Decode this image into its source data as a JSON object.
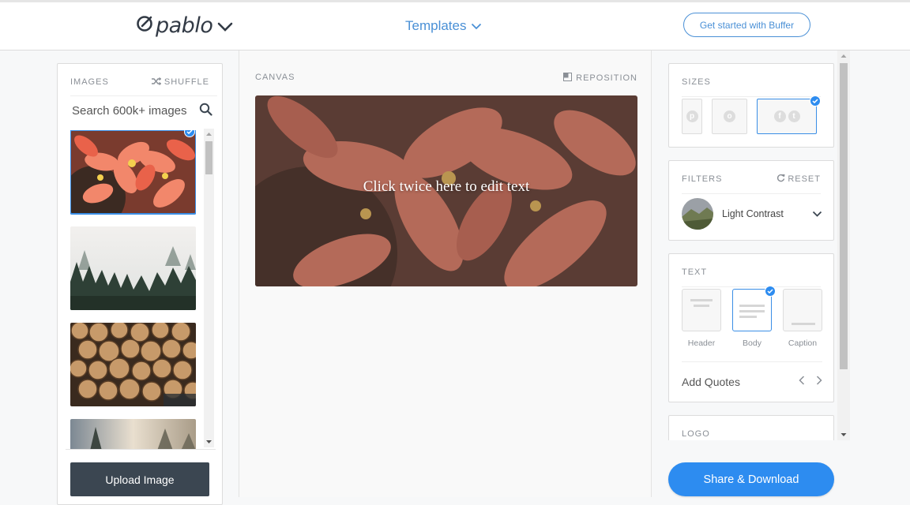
{
  "header": {
    "logo": "pablo",
    "templates_label": "Templates",
    "cta_label": "Get started with Buffer"
  },
  "images_panel": {
    "title": "IMAGES",
    "shuffle_label": "SHUFFLE",
    "search_placeholder": "Search 600k+ images",
    "upload_label": "Upload Image"
  },
  "canvas": {
    "title": "CANVAS",
    "reposition_label": "REPOSITION",
    "overlay_text": "Click twice here to edit text"
  },
  "sizes": {
    "title": "SIZES",
    "options": [
      "pinterest-icon",
      "instagram-icon",
      "facebook-twitter-icons"
    ],
    "selected": "facebook-twitter-icons"
  },
  "filters": {
    "title": "FILTERS",
    "reset_label": "RESET",
    "selected": "Light Contrast"
  },
  "text": {
    "title": "TEXT",
    "options": [
      {
        "label": "Header"
      },
      {
        "label": "Body"
      },
      {
        "label": "Caption"
      }
    ],
    "selected": "Body",
    "quotes_label": "Add Quotes"
  },
  "logo_section": {
    "title": "LOGO"
  },
  "share_label": "Share & Download",
  "colors": {
    "accent": "#2d8cf0",
    "link": "#4a90d6",
    "dark_button": "#3b4651"
  }
}
